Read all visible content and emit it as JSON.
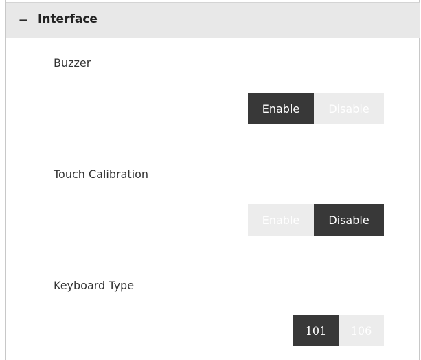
{
  "section": {
    "collapse_symbol": "−",
    "title": "Interface"
  },
  "settings": [
    {
      "label": "Buzzer",
      "options": [
        "Enable",
        "Disable"
      ],
      "selected": "Enable"
    },
    {
      "label": "Touch Calibration",
      "options": [
        "Enable",
        "Disable"
      ],
      "selected": "Disable"
    },
    {
      "label": "Keyboard Type",
      "options": [
        "101",
        "106"
      ],
      "selected": "101"
    }
  ],
  "colors": {
    "active_bg": "#383838",
    "inactive_bg": "#ececec",
    "header_bg": "#e8e8e8"
  }
}
